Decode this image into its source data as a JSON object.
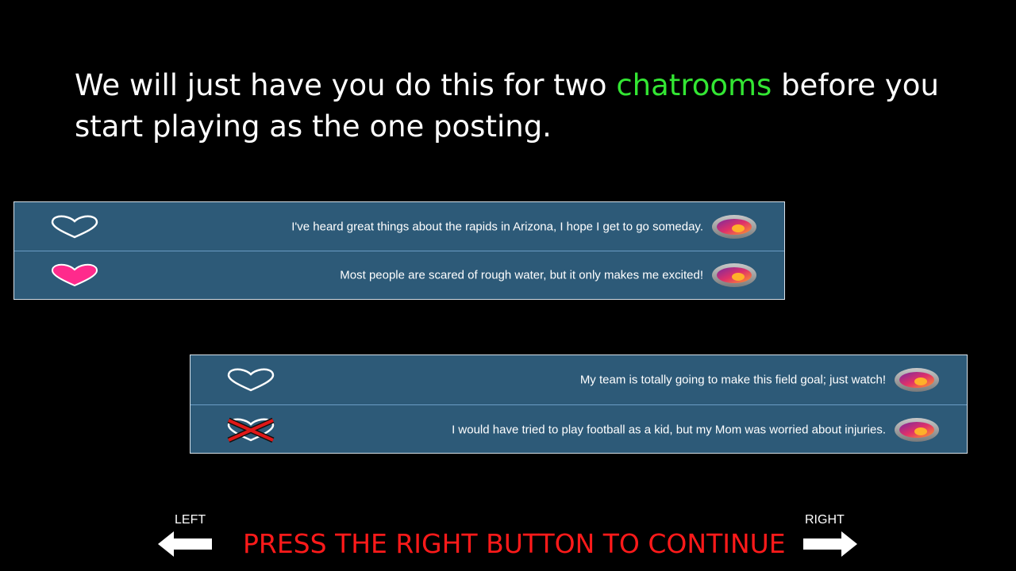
{
  "headline": {
    "part1": "We will just have you do this for two ",
    "highlight": "chatrooms",
    "part2": " before you start playing as the one posting.",
    "highlight_color": "#33e633"
  },
  "chatrooms": [
    {
      "posts": [
        {
          "text": "I've heard great things about the rapids in Arizona, I hope I get to go someday.",
          "like_state": "empty-heart-icon"
        },
        {
          "text": "Most people are scared of rough water, but it only makes me excited!",
          "like_state": "filled-heart-icon"
        }
      ]
    },
    {
      "posts": [
        {
          "text": "My team is totally going to make this field goal; just watch!",
          "like_state": "empty-heart-icon"
        },
        {
          "text": "I would have tried to play football as a kid, but my Mom was worried about injuries.",
          "like_state": "crossed-heart-icon"
        }
      ]
    }
  ],
  "nav": {
    "left_label": "LEFT",
    "right_label": "RIGHT",
    "continue_text": "PRESS THE RIGHT BUTTON TO CONTINUE"
  },
  "colors": {
    "background": "#000000",
    "panel": "#2d5a78",
    "heart_fill": "#ff2a8c",
    "continue_text": "#ff1a1a"
  }
}
